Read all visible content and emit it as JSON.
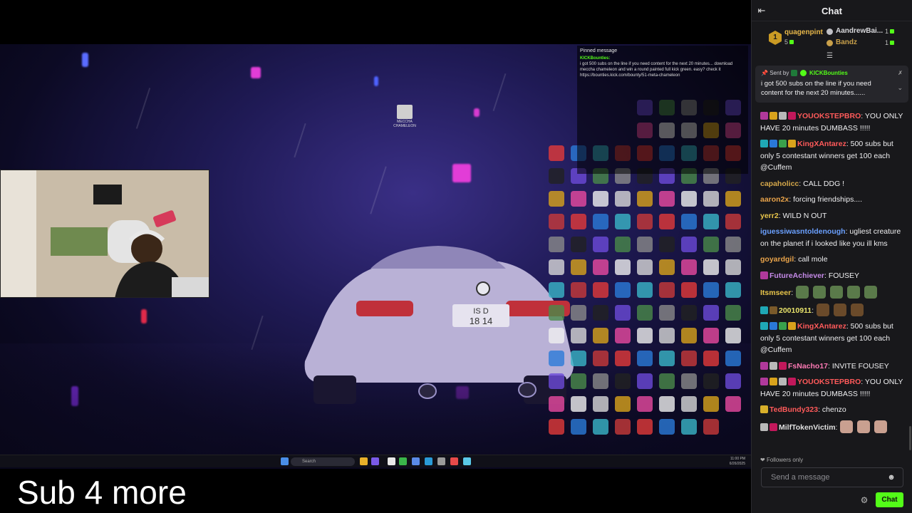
{
  "stream": {
    "caption": "Sub 4 more",
    "pinned_overlay": {
      "title": "Pinned message",
      "user": "KICKBounties:",
      "text": "i got 500 subs on the line if you need content for the next 20 minutes... download meccha chameleon and win a round painted full kick green. easy? check it https://bounties.kick.com/bounty/51-meta-chameleon"
    },
    "desktop_icon_label": "MECCHA CHAMELEON",
    "taskbar": {
      "search_label": "Search",
      "time": "11:00 PM",
      "date": "6/26/2025"
    }
  },
  "chat": {
    "title": "Chat",
    "leaderboard": [
      {
        "rank": "1",
        "name": "quagenpint",
        "count": "5",
        "color": "#e8b84a"
      },
      {
        "rank": "",
        "name": "AandrewBai...",
        "count": "1",
        "color": "#d8d8dc"
      },
      {
        "rank": "",
        "name": "Bandz",
        "count": "1",
        "color": "#c9a04a"
      }
    ],
    "pinned": {
      "sent_by_label": "Sent by",
      "user": "KICKBounties",
      "text": "i got 500 subs on the line if you need content for the next 20 minutes......"
    },
    "messages": [
      {
        "user": "YOUOKSTEPBRO",
        "color": "#ff5a5a",
        "text": ": YOU ONLY HAVE 20 minutes DUMBASS !!!!!",
        "badges": [
          "#b0399b",
          "#d8a21c",
          "#b9b9b9",
          "#c2185b"
        ]
      },
      {
        "user": "KingXAntarez",
        "color": "#ff5a5a",
        "text": ": 500 subs but only 5 contestant winners get 100 each @Cuffem",
        "badges": [
          "#1fa8b5",
          "#2a78d8",
          "#39a04c",
          "#d8a21c"
        ]
      },
      {
        "user": "capaholicc",
        "color": "#d4a74a",
        "text": ": CALL DDG !",
        "badges": []
      },
      {
        "user": "aaron2x",
        "color": "#e8a34a",
        "text": ": forcing friendships....",
        "badges": []
      },
      {
        "user": "yerr2",
        "color": "#e8c54a",
        "text": ": WILD N OUT",
        "badges": []
      },
      {
        "user": "iguessiwasntoldenough",
        "color": "#6aa0ff",
        "text": ": ugliest creature on the planet if i looked like you ill kms",
        "badges": []
      },
      {
        "user": "goyardgil",
        "color": "#e8a34a",
        "text": ": call mole",
        "badges": []
      },
      {
        "user": "FutureAchiever",
        "color": "#c58ae8",
        "text": ": FOUSEY",
        "badges": [
          "#b0399b"
        ]
      },
      {
        "user": "Itsmseer",
        "color": "#e8c54a",
        "text": ":",
        "badges": [],
        "emotes": 5
      },
      {
        "user": "20010911",
        "color": "#e8e36a",
        "text": ":",
        "badges": [
          "#1fa8b5",
          "#7a5a2a"
        ],
        "emotes": 3
      },
      {
        "user": "KingXAntarez",
        "color": "#ff5a5a",
        "text": ": 500 subs but only 5 contestant winners get 100 each @Cuffem",
        "badges": [
          "#1fa8b5",
          "#2a78d8",
          "#39a04c",
          "#d8a21c"
        ]
      },
      {
        "user": "FsNacho17",
        "color": "#ff7ab5",
        "text": ": INVITE FOUSEY",
        "badges": [
          "#b0399b",
          "#b9b9b9",
          "#c2185b"
        ]
      },
      {
        "user": "YOUOKSTEPBRO",
        "color": "#ff5a5a",
        "text": ": YOU ONLY HAVE 20 minutes DUMBASS !!!!!",
        "badges": [
          "#b0399b",
          "#d8a21c",
          "#b9b9b9",
          "#c2185b"
        ]
      },
      {
        "user": "TedBundy323",
        "color": "#ff5a5a",
        "text": ": chenzo",
        "badges": [
          "#d8b02a"
        ]
      },
      {
        "user": "MilfTokenVictim",
        "color": "#e0e0e0",
        "text": ":",
        "badges": [
          "#b9b9b9",
          "#c2185b"
        ],
        "emotes": 3
      }
    ],
    "followers_only": "Followers only",
    "input_placeholder": "Send a message",
    "send_button": "Chat",
    "accent": "#53fc18"
  }
}
